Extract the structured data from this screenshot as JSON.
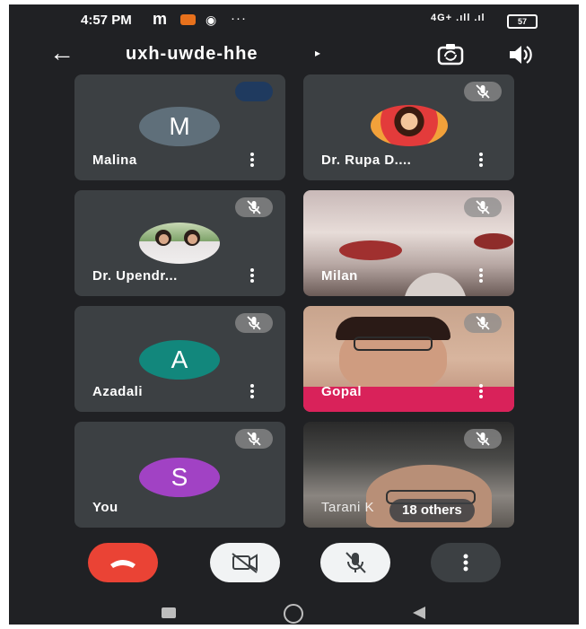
{
  "status": {
    "time": "4:57 PM",
    "carrier_glyph": "m",
    "chrome_glyph": "◉",
    "dots": "···",
    "network": "4G+ .ıll .ıl",
    "battery": "57"
  },
  "meeting": {
    "code": "uxh-uwde-hhe",
    "caret": "▸",
    "back_glyph": "←"
  },
  "participants": [
    {
      "name": "Malina",
      "initial": "M",
      "avatar_color": "#5f6f7a",
      "kind": "initial"
    },
    {
      "name": "Dr. Rupa D....",
      "kind": "photo"
    },
    {
      "name": "Dr. Upendr...",
      "kind": "photo"
    },
    {
      "name": "Milan",
      "kind": "video"
    },
    {
      "name": "Azadali",
      "initial": "A",
      "avatar_color": "#12877c",
      "kind": "initial"
    },
    {
      "name": "Gopal",
      "kind": "video"
    },
    {
      "name": "You",
      "initial": "S",
      "avatar_color": "#a142c4",
      "kind": "initial"
    },
    {
      "name": "Tarani K",
      "kind": "video"
    }
  ],
  "others_label": "18 others",
  "controls": {
    "end_call_color": "#ea4335",
    "icons": [
      "phone-hangup-icon",
      "camera-off-icon",
      "mic-off-icon",
      "more-vert-icon"
    ]
  }
}
